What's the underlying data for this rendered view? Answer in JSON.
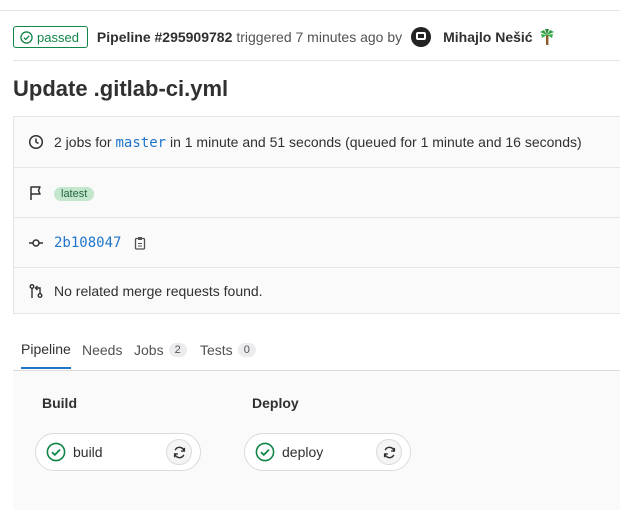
{
  "header": {
    "status": "passed",
    "pipeline_id": "Pipeline #295909782",
    "triggered_text": "triggered 7 minutes ago by",
    "author": "Mihajlo Nešić",
    "emoji": "palm-tree"
  },
  "commit_title": "Update .gitlab-ci.yml",
  "info": {
    "jobs_prefix": "2 jobs for",
    "branch": "master",
    "jobs_suffix": "in 1 minute and 51 seconds (queued for 1 minute and 16 seconds)",
    "tag": "latest",
    "commit_sha": "2b108047",
    "merge_requests": "No related merge requests found."
  },
  "tabs": [
    {
      "label": "Pipeline",
      "count": null,
      "active": true
    },
    {
      "label": "Needs",
      "count": null,
      "active": false
    },
    {
      "label": "Jobs",
      "count": "2",
      "active": false
    },
    {
      "label": "Tests",
      "count": "0",
      "active": false
    }
  ],
  "stages": [
    {
      "title": "Build",
      "job": "build",
      "status": "success"
    },
    {
      "title": "Deploy",
      "job": "deploy",
      "status": "success"
    }
  ],
  "colors": {
    "success": "#108548",
    "link": "#1f75cb",
    "text": "#303030"
  }
}
